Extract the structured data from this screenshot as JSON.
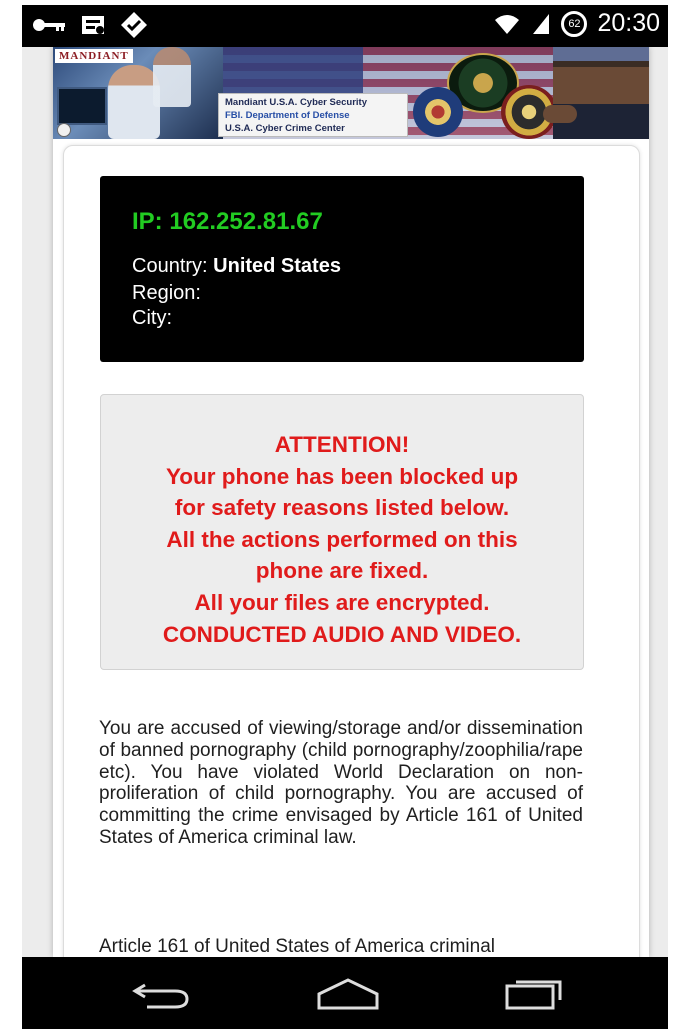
{
  "status_bar": {
    "time": "20:30",
    "battery_level": "62",
    "icons": [
      "key-icon",
      "notification-icon",
      "sync-icon",
      "wifi-icon",
      "signal-icon",
      "battery-icon"
    ]
  },
  "banner": {
    "brand": "MANDIANT",
    "lines": [
      "Mandiant U.S.A. Cyber Security",
      "FBI. Department of Defense",
      "U.S.A. Cyber Crime Center"
    ]
  },
  "ip_info": {
    "ip_label": "IP:",
    "ip_value": "162.252.81.67",
    "country_label": "Country:",
    "country_value": "United States",
    "region_label": "Region:",
    "city_label": "City:"
  },
  "attention": {
    "lines": [
      "ATTENTION!",
      "Your phone has been blocked up",
      "for safety reasons listed below.",
      "All the actions performed on this",
      "phone are fixed.",
      "All your files are encrypted.",
      "CONDUCTED AUDIO AND VIDEO."
    ],
    "color": "#e01b1b"
  },
  "body": {
    "paragraph1": "You are accused of viewing/storage and/or dissemination of banned pornography (child pornography/zoophilia/rape etc). You have violated World Declaration on non-proliferation of child pornography. You are accused of committing the crime envisaged by Article 161 of United States of America criminal law.",
    "paragraph2": "Article 161 of United States of America criminal"
  },
  "colors": {
    "ip_green": "#22cc22",
    "alert_red": "#e01b1b",
    "ip_box_bg": "#000000"
  },
  "nav_bar": {
    "buttons": [
      "back-icon",
      "home-icon",
      "recents-icon"
    ]
  }
}
